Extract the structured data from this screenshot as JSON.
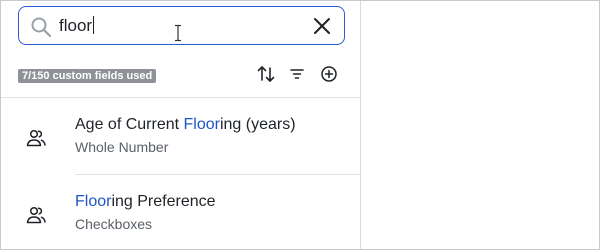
{
  "search": {
    "value": "floor",
    "placeholder": ""
  },
  "fields_summary": {
    "badge": "7/150 custom fields used"
  },
  "toolbar": {
    "sort_icon": "sort-arrows-icon",
    "filter_icon": "filter-icon",
    "add_icon": "add-circle-icon"
  },
  "results": [
    {
      "name_before": "Age of Current ",
      "name_match": "Floor",
      "name_after": "ing (years)",
      "type": "Whole Number",
      "icon": "person-group-icon"
    },
    {
      "name_before": "",
      "name_match": "Floor",
      "name_after": "ing Preference",
      "type": "Checkboxes",
      "icon": "person-group-icon"
    }
  ],
  "colors": {
    "accent": "#2b5bd7",
    "highlight": "#1f56c5",
    "badge_bg": "#8e9196"
  }
}
